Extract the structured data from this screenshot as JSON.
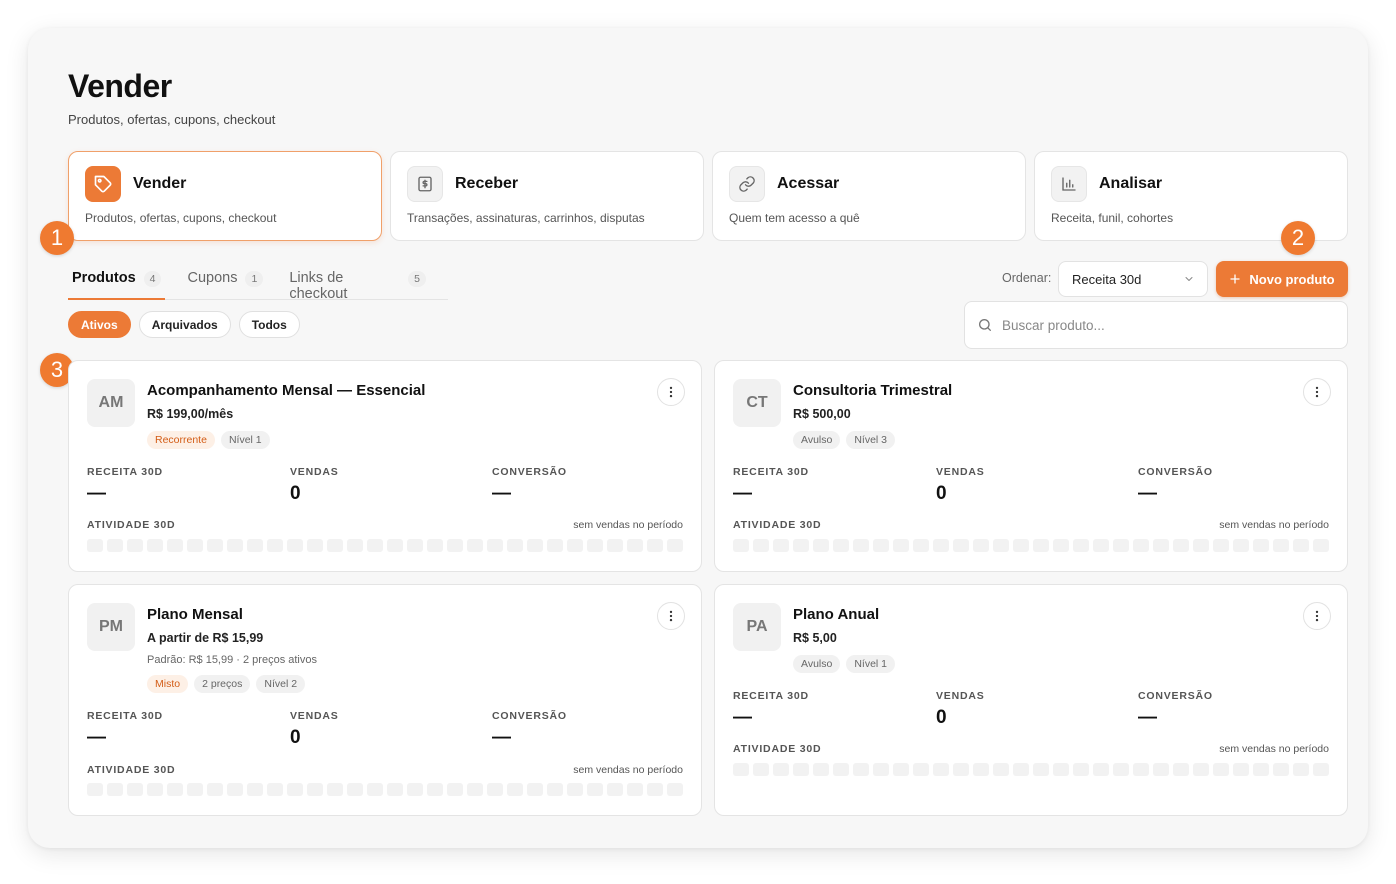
{
  "colors": {
    "accent": "#ec7a36",
    "accent_soft": "#fdf0e6",
    "badge": "#ef7a30",
    "muted": "#f2f2f2"
  },
  "page": {
    "title": "Vender",
    "subtitle": "Produtos, ofertas, cupons, checkout"
  },
  "nav_cards": [
    {
      "title": "Vender",
      "desc": "Produtos, ofertas, cupons, checkout",
      "icon": "tag-icon",
      "active": true
    },
    {
      "title": "Receber",
      "desc": "Transações, assinaturas, carrinhos, disputas",
      "icon": "receipt-dollar-icon",
      "active": false
    },
    {
      "title": "Acessar",
      "desc": "Quem tem acesso a quê",
      "icon": "link-icon",
      "active": false
    },
    {
      "title": "Analisar",
      "desc": "Receita, funil, cohortes",
      "icon": "bar-chart-icon",
      "active": false
    }
  ],
  "annotations": [
    "1",
    "2",
    "3"
  ],
  "tabs": [
    {
      "label": "Produtos",
      "count": "4",
      "active": true
    },
    {
      "label": "Cupons",
      "count": "1",
      "active": false
    },
    {
      "label": "Links de checkout",
      "count": "5",
      "active": false
    }
  ],
  "filters": [
    {
      "label": "Ativos",
      "active": true
    },
    {
      "label": "Arquivados",
      "active": false
    },
    {
      "label": "Todos",
      "active": false
    }
  ],
  "sort": {
    "label": "Ordenar:",
    "value": "Receita 30d"
  },
  "new_button": {
    "label": "Novo produto"
  },
  "search": {
    "placeholder": "Buscar produto..."
  },
  "stat_labels": {
    "revenue": "RECEITA 30D",
    "sales": "VENDAS",
    "conversion": "CONVERSÃO",
    "activity": "ATIVIDADE 30D",
    "no_sales": "sem vendas no período"
  },
  "products": [
    {
      "initials": "AM",
      "name": "Acompanhamento Mensal — Essencial",
      "price": "R$ 199,00/mês",
      "note": "",
      "tags": [
        {
          "text": "Recorrente",
          "orange": true
        },
        {
          "text": "Nível 1",
          "orange": false
        }
      ],
      "revenue": "—",
      "sales": "0",
      "conversion": "—"
    },
    {
      "initials": "CT",
      "name": "Consultoria Trimestral",
      "price": "R$ 500,00",
      "note": "",
      "tags": [
        {
          "text": "Avulso",
          "orange": false
        },
        {
          "text": "Nível 3",
          "orange": false
        }
      ],
      "revenue": "—",
      "sales": "0",
      "conversion": "—"
    },
    {
      "initials": "PM",
      "name": "Plano Mensal",
      "price": "A partir de R$ 15,99",
      "note": "Padrão: R$ 15,99 · 2 preços ativos",
      "tags": [
        {
          "text": "Misto",
          "orange": true
        },
        {
          "text": "2 preços",
          "orange": false
        },
        {
          "text": "Nível 2",
          "orange": false
        }
      ],
      "revenue": "—",
      "sales": "0",
      "conversion": "—"
    },
    {
      "initials": "PA",
      "name": "Plano Anual",
      "price": "R$ 5,00",
      "note": "",
      "tags": [
        {
          "text": "Avulso",
          "orange": false
        },
        {
          "text": "Nível 1",
          "orange": false
        }
      ],
      "revenue": "—",
      "sales": "0",
      "conversion": "—"
    }
  ]
}
